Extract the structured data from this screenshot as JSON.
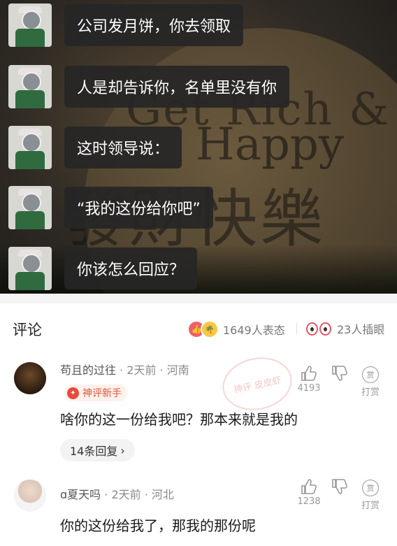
{
  "chat": {
    "messages": [
      "公司发月饼，你去领取",
      "人是却告诉你，名单里没有你",
      "这时领导说：",
      "“我的这份给你吧”",
      "你该怎么回应？"
    ],
    "background_text": [
      "Get Rich &",
      "Happy",
      "發財快樂"
    ]
  },
  "comments_header": {
    "title": "评论",
    "reactions": "1649人表态",
    "peek": "23人插眼"
  },
  "comments": [
    {
      "author": "苟且的过往",
      "time": "2天前",
      "location": "河南",
      "badge": "神评新手",
      "text": "啥你的这一份给我吧？那本来就是我的",
      "replies": "14条回复",
      "likes": "4193",
      "tip": "打赏",
      "stamp": "神评 皮皮虾"
    },
    {
      "author": "夏天吗",
      "time": "2天前",
      "location": "河北",
      "text": "你的这份给我了，那我的那份呢",
      "likes": "1238",
      "tip": "打赏"
    }
  ],
  "colors": {
    "badge": "#e84a3a",
    "reaction_red": "#f25d6b",
    "reaction_yellow": "#f6c846"
  }
}
